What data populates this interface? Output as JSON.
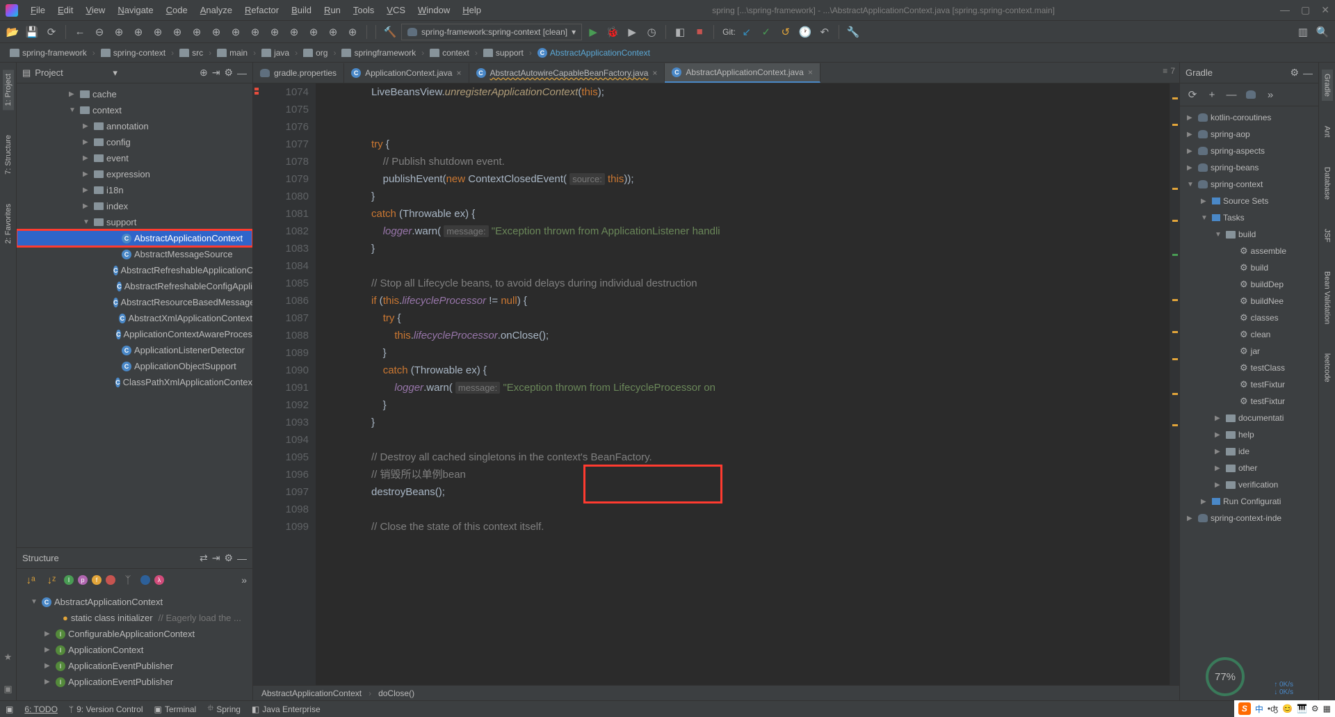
{
  "window": {
    "title": "spring [...\\spring-framework] - ...\\AbstractApplicationContext.java [spring.spring-context.main]"
  },
  "menu": [
    "File",
    "Edit",
    "View",
    "Navigate",
    "Code",
    "Analyze",
    "Refactor",
    "Build",
    "Run",
    "Tools",
    "VCS",
    "Window",
    "Help"
  ],
  "toolbar": {
    "run_config": "spring-framework:spring-context [clean]",
    "git_label": "Git:"
  },
  "breadcrumbs": [
    "spring-framework",
    "spring-context",
    "src",
    "main",
    "java",
    "org",
    "springframework",
    "context",
    "support",
    "AbstractApplicationContext"
  ],
  "project_panel": {
    "title": "Project",
    "tree": [
      {
        "indent": 75,
        "arrow": "▶",
        "type": "folder",
        "label": "cache"
      },
      {
        "indent": 75,
        "arrow": "▼",
        "type": "folder",
        "label": "context"
      },
      {
        "indent": 95,
        "arrow": "▶",
        "type": "folder",
        "label": "annotation"
      },
      {
        "indent": 95,
        "arrow": "▶",
        "type": "folder",
        "label": "config"
      },
      {
        "indent": 95,
        "arrow": "▶",
        "type": "folder",
        "label": "event"
      },
      {
        "indent": 95,
        "arrow": "▶",
        "type": "folder",
        "label": "expression"
      },
      {
        "indent": 95,
        "arrow": "▶",
        "type": "folder",
        "label": "i18n"
      },
      {
        "indent": 95,
        "arrow": "▶",
        "type": "folder",
        "label": "index"
      },
      {
        "indent": 95,
        "arrow": "▼",
        "type": "folder",
        "label": "support"
      },
      {
        "indent": 135,
        "arrow": "",
        "type": "class",
        "label": "AbstractApplicationContext",
        "selected": true,
        "hl": true
      },
      {
        "indent": 135,
        "arrow": "",
        "type": "class",
        "label": "AbstractMessageSource"
      },
      {
        "indent": 135,
        "arrow": "",
        "type": "class",
        "label": "AbstractRefreshableApplicationC"
      },
      {
        "indent": 135,
        "arrow": "",
        "type": "class",
        "label": "AbstractRefreshableConfigAppli"
      },
      {
        "indent": 135,
        "arrow": "",
        "type": "class",
        "label": "AbstractResourceBasedMessage"
      },
      {
        "indent": 135,
        "arrow": "",
        "type": "class",
        "label": "AbstractXmlApplicationContext"
      },
      {
        "indent": 135,
        "arrow": "",
        "type": "class",
        "label": "ApplicationContextAwareProces"
      },
      {
        "indent": 135,
        "arrow": "",
        "type": "class",
        "label": "ApplicationListenerDetector"
      },
      {
        "indent": 135,
        "arrow": "",
        "type": "class",
        "label": "ApplicationObjectSupport"
      },
      {
        "indent": 135,
        "arrow": "",
        "type": "class",
        "label": "ClassPathXmlApplicationContex"
      }
    ]
  },
  "structure_panel": {
    "title": "Structure",
    "items": [
      {
        "type": "class",
        "label": "AbstractApplicationContext",
        "indent": 20,
        "arrow": "▼"
      },
      {
        "type": "init",
        "label": "static class initializer",
        "comment": "// Eagerly load the ...",
        "indent": 50
      },
      {
        "type": "interface",
        "label": "ConfigurableApplicationContext",
        "indent": 40,
        "arrow": "▶"
      },
      {
        "type": "interface",
        "label": "ApplicationContext",
        "indent": 40,
        "arrow": "▶"
      },
      {
        "type": "interface",
        "label": "ApplicationEventPublisher",
        "indent": 40,
        "arrow": "▶"
      },
      {
        "type": "interface",
        "label": "ApplicationEventPublisher",
        "indent": 40,
        "arrow": "▶"
      }
    ]
  },
  "editor": {
    "tabs": [
      {
        "icon": "gradle",
        "label": "gradle.properties",
        "active": false
      },
      {
        "icon": "class",
        "label": "ApplicationContext.java",
        "active": false,
        "close": true
      },
      {
        "icon": "class",
        "label": "AbstractAutowireCapableBeanFactory.java",
        "dirty": true,
        "active": false,
        "close": true
      },
      {
        "icon": "class",
        "label": "AbstractApplicationContext.java",
        "active": true,
        "close": true
      }
    ],
    "first_line": 1074,
    "lines": [
      "            LiveBeansView.<m>unregisterApplicationContext</m>(<k>this</k>);",
      "",
      "",
      "            <k>try</k> {",
      "                <c>// Publish shutdown event.</c>",
      "                publishEvent(<k>new</k> ContextClosedEvent( <h>source:</h> <k>this</k>));",
      "            }",
      "            <k>catch</k> (Throwable ex) {",
      "                <f>logger</f>.warn( <h>message:</h> <s>\"Exception thrown from ApplicationListener handli</s>",
      "            }",
      "",
      "            <c>// Stop all Lifecycle beans, to avoid delays during individual destruction</c>",
      "            <k>if</k> (<k>this</k>.<f>lifecycleProcessor</f> != <k>null</k>) {",
      "                <k>try</k> {",
      "                    <k>this</k>.<f>lifecycleProcessor</f>.onClose();",
      "                }",
      "                <k>catch</k> (Throwable ex) {",
      "                    <f>logger</f>.warn( <h>message:</h> <s>\"Exception thrown from LifecycleProcessor on</s>",
      "                }",
      "            }",
      "",
      "            <c>// Destroy all cached singletons in the context's BeanFactory.</c>",
      "            <c>// 销毁所以单例bean</c>",
      "            destroyBeans();",
      "",
      "            <c>// Close the state of this context itself.</c>"
    ],
    "breadcrumb": [
      "AbstractApplicationContext",
      "doClose()"
    ],
    "insp_count": "7"
  },
  "gradle_panel": {
    "title": "Gradle",
    "tree": [
      {
        "indent": 10,
        "arrow": "▶",
        "type": "elephant",
        "label": "kotlin-coroutines"
      },
      {
        "indent": 10,
        "arrow": "▶",
        "type": "elephant",
        "label": "spring-aop"
      },
      {
        "indent": 10,
        "arrow": "▶",
        "type": "elephant",
        "label": "spring-aspects"
      },
      {
        "indent": 10,
        "arrow": "▶",
        "type": "elephant",
        "label": "spring-beans"
      },
      {
        "indent": 10,
        "arrow": "▼",
        "type": "elephant",
        "label": "spring-context"
      },
      {
        "indent": 30,
        "arrow": "▶",
        "type": "box",
        "label": "Source Sets"
      },
      {
        "indent": 30,
        "arrow": "▼",
        "type": "box",
        "label": "Tasks"
      },
      {
        "indent": 50,
        "arrow": "▼",
        "type": "folder",
        "label": "build"
      },
      {
        "indent": 70,
        "arrow": "",
        "type": "gear",
        "label": "assemble"
      },
      {
        "indent": 70,
        "arrow": "",
        "type": "gear",
        "label": "build"
      },
      {
        "indent": 70,
        "arrow": "",
        "type": "gear",
        "label": "buildDep"
      },
      {
        "indent": 70,
        "arrow": "",
        "type": "gear",
        "label": "buildNee"
      },
      {
        "indent": 70,
        "arrow": "",
        "type": "gear",
        "label": "classes"
      },
      {
        "indent": 70,
        "arrow": "",
        "type": "gear",
        "label": "clean"
      },
      {
        "indent": 70,
        "arrow": "",
        "type": "gear",
        "label": "jar"
      },
      {
        "indent": 70,
        "arrow": "",
        "type": "gear",
        "label": "testClass"
      },
      {
        "indent": 70,
        "arrow": "",
        "type": "gear",
        "label": "testFixtur"
      },
      {
        "indent": 70,
        "arrow": "",
        "type": "gear",
        "label": "testFixtur"
      },
      {
        "indent": 50,
        "arrow": "▶",
        "type": "folder",
        "label": "documentati"
      },
      {
        "indent": 50,
        "arrow": "▶",
        "type": "folder",
        "label": "help"
      },
      {
        "indent": 50,
        "arrow": "▶",
        "type": "folder",
        "label": "ide"
      },
      {
        "indent": 50,
        "arrow": "▶",
        "type": "folder",
        "label": "other"
      },
      {
        "indent": 50,
        "arrow": "▶",
        "type": "folder",
        "label": "verification"
      },
      {
        "indent": 30,
        "arrow": "▶",
        "type": "box",
        "label": "Run Configurati"
      },
      {
        "indent": 10,
        "arrow": "▶",
        "type": "elephant",
        "label": "spring-context-inde"
      }
    ]
  },
  "status": {
    "todo": "6: TODO",
    "vc": "9: Version Control",
    "term": "Terminal",
    "spring": "Spring",
    "java_ee": "Java Enterprise"
  },
  "perf": {
    "pct": "77%",
    "up": "0K/s",
    "down": "0K/s"
  },
  "left_tools": [
    "1: Project",
    "7: Structure",
    "2: Favorites"
  ],
  "right_tools": [
    "Gradle",
    "Ant",
    "Database",
    "JSF",
    "Bean Validation",
    "leetcode"
  ],
  "ime": {
    "lang": "中"
  }
}
